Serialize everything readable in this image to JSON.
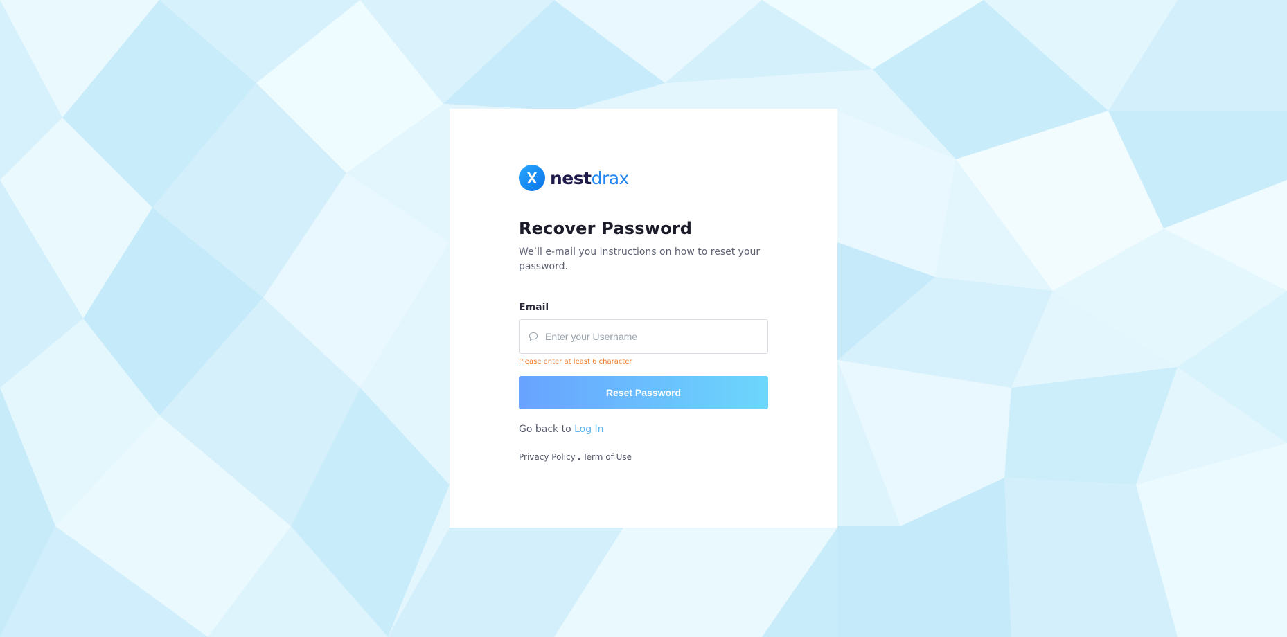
{
  "brand": {
    "name_bold": "nest",
    "name_light": "drax",
    "logo_icon": "nestdrax-logo-icon"
  },
  "form": {
    "title": "Recover Password",
    "subtitle": "We’ll e-mail you instructions on how to reset your password.",
    "email_label": "Email",
    "email_placeholder": "Enter your Username",
    "email_value": "",
    "email_icon": "speech-bubble-icon",
    "error_message": "Please enter at least 6 character",
    "submit_label": "Reset Password",
    "back_prefix": "Go back to",
    "back_link": "Log In"
  },
  "footer": {
    "privacy": "Privacy Policy",
    "separator": ".",
    "terms": "Term of Use"
  },
  "colors": {
    "background": "#e4f6fd",
    "brand_dark": "#1f1b4d",
    "brand_blue": "#1e88f0",
    "button_gradient_start": "#68a3ff",
    "button_gradient_end": "#6cd7fc",
    "error": "#f07b2c",
    "link": "#5cb5ee"
  }
}
